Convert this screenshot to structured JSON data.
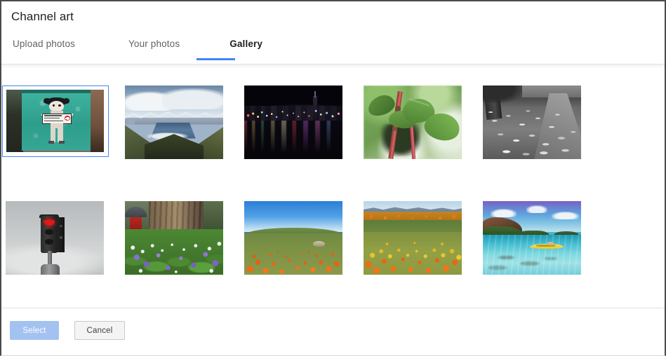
{
  "dialog": {
    "title": "Channel art",
    "tabs": [
      {
        "label": "Upload photos",
        "active": false
      },
      {
        "label": "Your photos",
        "active": false
      },
      {
        "label": "Gallery",
        "active": true
      }
    ],
    "accent_color": "#4285f4",
    "selection_border_color": "#4285f4"
  },
  "gallery": {
    "rows": [
      {
        "items": [
          {
            "name": "street-art-girl-sign",
            "description": "Street art stencil of a girl holding a sign on a teal wall",
            "selected": true
          },
          {
            "name": "mountain-valley-lake",
            "description": "Mountain valley with lake and low clouds",
            "selected": false
          },
          {
            "name": "night-city-skyline",
            "description": "Night city skyline with colored lights reflecting on water",
            "selected": false
          },
          {
            "name": "green-leaves-red-stem",
            "description": "Close-up of green leaves on red stems",
            "selected": false
          },
          {
            "name": "fallen-leaves-bw",
            "description": "Black and white fallen leaves on a path",
            "selected": false
          }
        ]
      },
      {
        "items": [
          {
            "name": "traffic-light-red-heart",
            "description": "Traffic light with red heart-shaped signal against grey sky",
            "selected": false
          },
          {
            "name": "purple-flowers-tree",
            "description": "Purple and white wildflowers at the base of a tree trunk",
            "selected": false
          },
          {
            "name": "orange-poppy-hillside",
            "description": "Orange poppies on a hillside under clear blue sky",
            "selected": false
          },
          {
            "name": "wildflower-field-mountains",
            "description": "Wide field of orange and yellow wildflowers with distant mountains",
            "selected": false
          },
          {
            "name": "tropical-lagoon-kayak",
            "description": "Turquoise tropical lagoon with a yellow kayak and island",
            "selected": false
          }
        ]
      }
    ]
  },
  "footer": {
    "select_label": "Select",
    "cancel_label": "Cancel",
    "select_enabled": false,
    "select_color": "#a3c2f0",
    "cancel_color": "#f4f4f4"
  }
}
